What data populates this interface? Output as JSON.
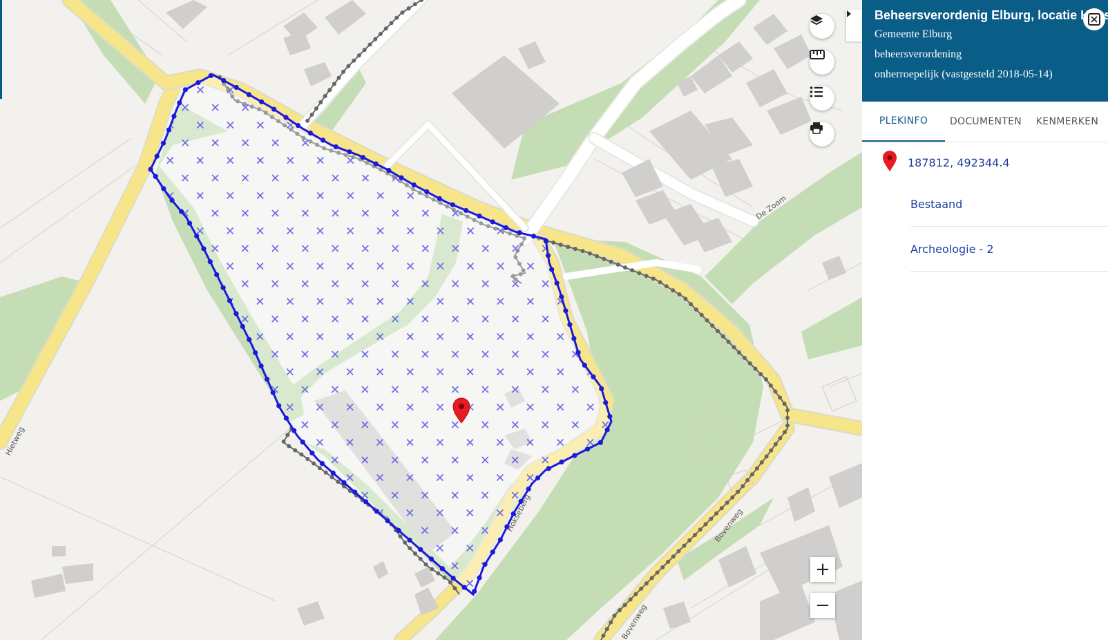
{
  "map": {
    "pin_color": "#e81b23",
    "boundary_color": "#1a1adb",
    "streets": [
      "De Zoom",
      "Bovenweg",
      "Bovenweg",
      "Hokseberg",
      "Hietweg"
    ]
  },
  "controls": {
    "layers_icon": "layers-icon",
    "measure_icon": "ruler-icon",
    "legend_icon": "list-icon",
    "print_icon": "printer-icon",
    "zoom_in": "+",
    "zoom_out": "−"
  },
  "panel": {
    "title": "Beheersverordenig Elburg, locatie Hokseberg",
    "municipality": "Gemeente Elburg",
    "type": "beheersverordening",
    "status": "onherroepelijk (vastgesteld 2018-05-14)",
    "tabs": [
      {
        "label": "PLEKINFO",
        "active": true
      },
      {
        "label": "DOCUMENTEN",
        "active": false
      },
      {
        "label": "KENMERKEN",
        "active": false
      }
    ],
    "coordinates": "187812, 492344.4",
    "items": [
      "Bestaand",
      "Archeologie - 2"
    ]
  }
}
